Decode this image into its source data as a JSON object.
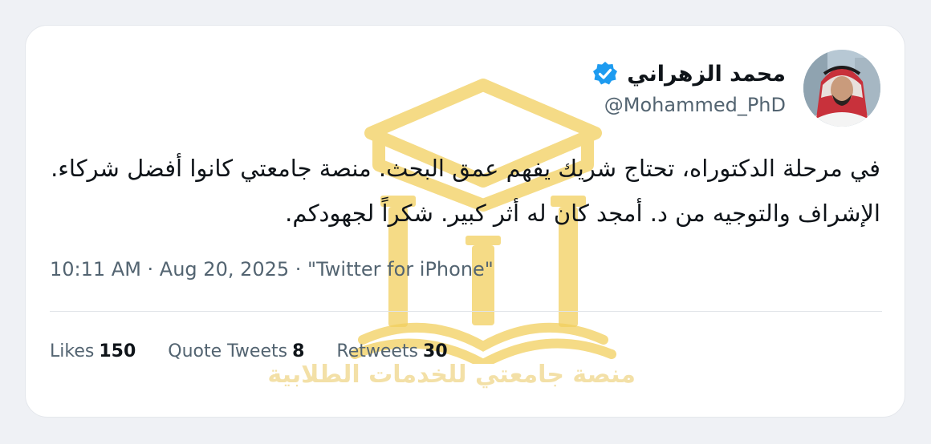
{
  "tweet": {
    "author": {
      "display_name": "محمد الزهراني",
      "handle": "@Mohammed_PhD",
      "verified": true
    },
    "text": "في مرحلة الدكتوراه، تحتاج شريك يفهم عمق البحث. منصة جامعتي كانوا أفضل شركاء. الإشراف والتوجيه من د. أمجد كان له أثر كبير. شكراً لجهودكم.",
    "timestamp": "10:11 AM · Aug 20, 2025 · \"Twitter for iPhone\"",
    "stats": {
      "likes_label": "Likes",
      "likes_count": "150",
      "quotes_label": "Quote Tweets",
      "quotes_count": "8",
      "retweets_label": "Retweets",
      "retweets_count": "30"
    }
  },
  "watermark": {
    "text": "منصة جامعتي للخدمات الطلابية"
  },
  "colors": {
    "background": "#eff1f5",
    "card": "#ffffff",
    "text_primary": "#0f1419",
    "text_secondary": "#536471",
    "verified": "#1d9bf0",
    "watermark": "#f2cf5e"
  },
  "icons": {
    "verified": "verified-badge-icon",
    "watermark_logo": "graduation-cap-book-logo-icon"
  }
}
